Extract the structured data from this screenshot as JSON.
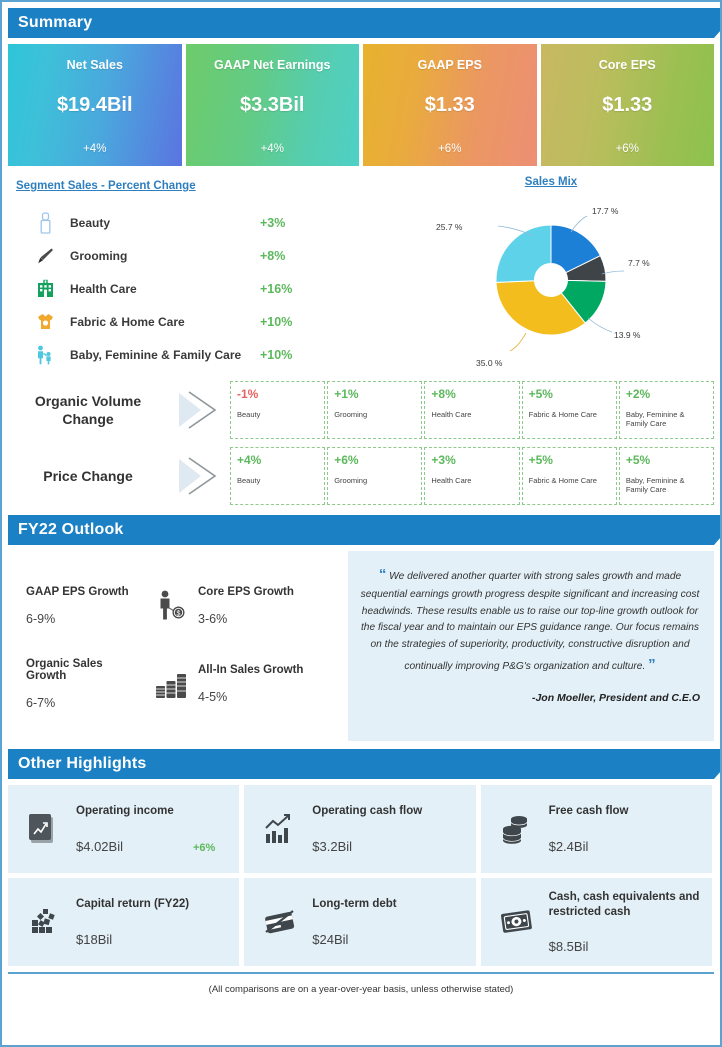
{
  "sections": {
    "summary_title": "Summary",
    "outlook_title": "FY22 Outlook",
    "highlights_title": "Other Highlights"
  },
  "summary": {
    "cards": [
      {
        "label": "Net Sales",
        "value": "$19.4Bil",
        "delta": "+4%"
      },
      {
        "label": "GAAP Net Earnings",
        "value": "$3.3Bil",
        "delta": "+4%"
      },
      {
        "label": "GAAP EPS",
        "value": "$1.33",
        "delta": "+6%"
      },
      {
        "label": "Core EPS",
        "value": "$1.33",
        "delta": "+6%"
      }
    ]
  },
  "segment_sales": {
    "title": "Segment Sales - Percent Change",
    "rows": [
      {
        "icon": "lipstick-icon",
        "name": "Beauty",
        "pct": "+3%"
      },
      {
        "icon": "brush-icon",
        "name": "Grooming",
        "pct": "+8%"
      },
      {
        "icon": "hospital-icon",
        "name": "Health Care",
        "pct": "+16%"
      },
      {
        "icon": "laundry-icon",
        "name": "Fabric & Home Care",
        "pct": "+10%"
      },
      {
        "icon": "family-icon",
        "name": "Baby, Feminine & Family Care",
        "pct": "+10%"
      }
    ]
  },
  "sales_mix": {
    "title": "Sales Mix"
  },
  "chart_data": {
    "type": "pie",
    "title": "Sales Mix",
    "subtype": "donut",
    "labels": [
      "Beauty",
      "Grooming",
      "Health Care",
      "Fabric & Home Care",
      "Baby, Feminine & Family Care"
    ],
    "values": [
      17.7,
      7.7,
      13.9,
      35.0,
      25.7
    ],
    "display_labels": [
      "17.7 %",
      "7.7 %",
      "13.9 %",
      "35.0 %",
      "25.7 %"
    ],
    "colors": [
      "#1b80d6",
      "#3f4449",
      "#00a862",
      "#f2bd1d",
      "#5ed2e8"
    ],
    "legend": "none",
    "start_angle_deg": 0,
    "direction": "clockwise",
    "hole_ratio": 0.3
  },
  "change_tables": [
    {
      "title": "Organic Volume Change",
      "cells": [
        {
          "value": "-1%",
          "negative": true,
          "label": "Beauty"
        },
        {
          "value": "+1%",
          "negative": false,
          "label": "Grooming"
        },
        {
          "value": "+8%",
          "negative": false,
          "label": "Health Care"
        },
        {
          "value": "+5%",
          "negative": false,
          "label": "Fabric & Home Care"
        },
        {
          "value": "+2%",
          "negative": false,
          "label": "Baby, Feminine & Family Care"
        }
      ]
    },
    {
      "title": "Price Change",
      "cells": [
        {
          "value": "+4%",
          "negative": false,
          "label": "Beauty"
        },
        {
          "value": "+6%",
          "negative": false,
          "label": "Grooming"
        },
        {
          "value": "+3%",
          "negative": false,
          "label": "Health Care"
        },
        {
          "value": "+5%",
          "negative": false,
          "label": "Fabric & Home Care"
        },
        {
          "value": "+5%",
          "negative": false,
          "label": "Baby, Feminine & Family Care"
        }
      ]
    }
  ],
  "outlook": {
    "items": [
      {
        "label": "GAAP EPS Growth",
        "value": "6-9%"
      },
      {
        "label": "Core EPS Growth",
        "value": "3-6%"
      },
      {
        "label": "Organic Sales Growth",
        "value": "6-7%"
      },
      {
        "label": "All-In Sales Growth",
        "value": "4-5%"
      }
    ],
    "quote": "We delivered another quarter with strong sales growth and made sequential earnings growth progress despite significant and increasing cost headwinds. These results enable us to raise our top-line growth outlook for the fiscal year and to maintain our EPS guidance range. Our focus remains on the strategies of superiority, productivity, constructive disruption and continually improving P&G's organization and culture.",
    "quote_open": "“",
    "quote_close": "”",
    "author": "-Jon Moeller, President and C.E.O"
  },
  "highlights": {
    "cards": [
      {
        "icon": "chart-document-icon",
        "label": "Operating income",
        "value": "$4.02Bil",
        "delta": "+6%"
      },
      {
        "icon": "bar-trend-icon",
        "label": "Operating cash flow",
        "value": "$3.2Bil",
        "delta": ""
      },
      {
        "icon": "coin-stack-icon",
        "label": "Free cash flow",
        "value": "$2.4Bil",
        "delta": ""
      },
      {
        "icon": "blocks-icon",
        "label": "Capital return (FY22)",
        "value": "$18Bil",
        "delta": ""
      },
      {
        "icon": "card-nodebt-icon",
        "label": "Long-term debt",
        "value": "$24Bil",
        "delta": ""
      },
      {
        "icon": "banknote-icon",
        "label": "Cash, cash equivalents and restricted cash",
        "value": "$8.5Bil",
        "delta": ""
      }
    ]
  },
  "footer": {
    "note": "(All comparisons are on a year-over-year basis, unless otherwise stated)"
  }
}
